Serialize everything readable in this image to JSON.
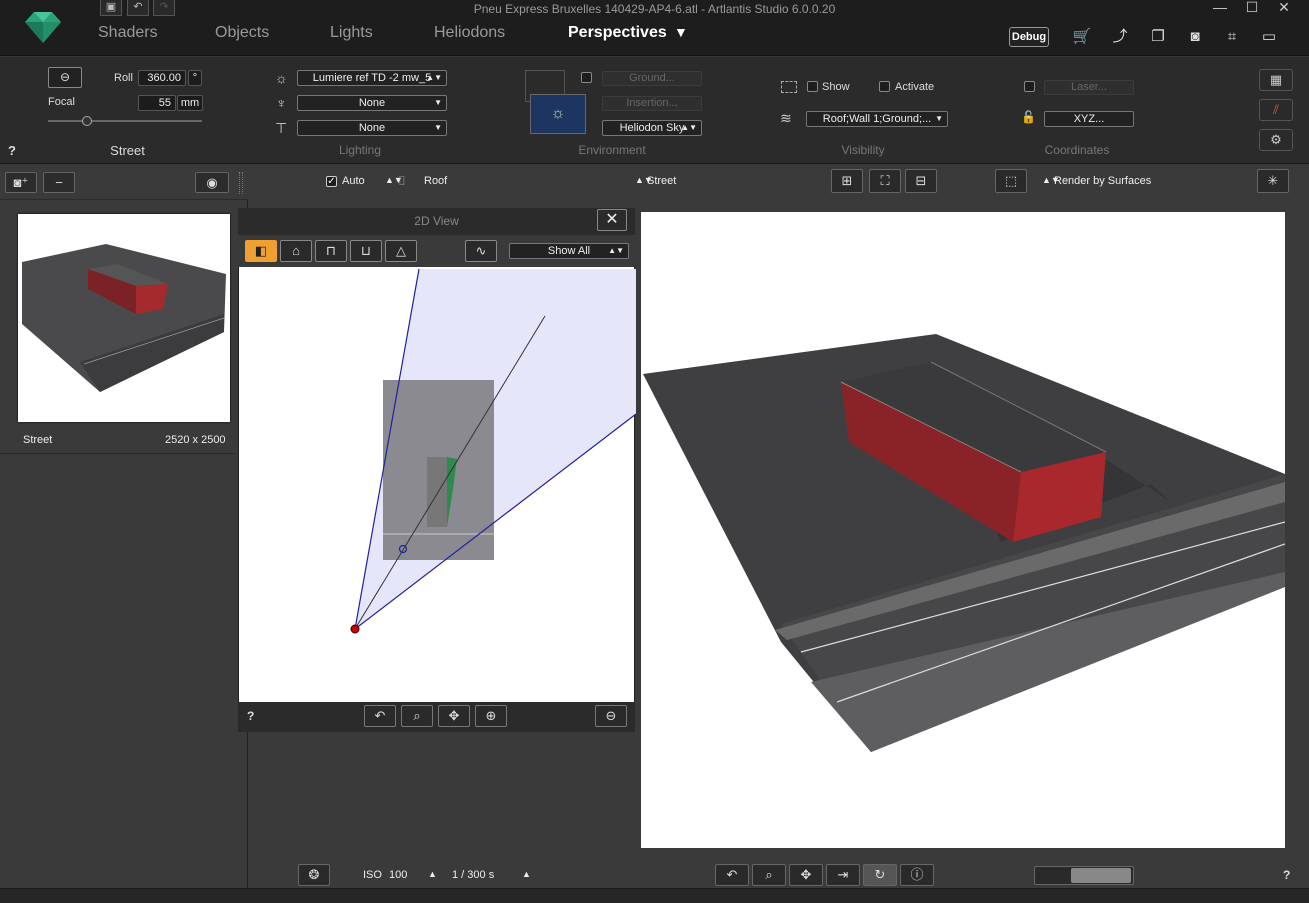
{
  "window": {
    "title": "Pneu Express Bruxelles 140429-AP4-6.atl - Artlantis Studio 6.0.0.20",
    "quick_save_icon": "save-icon",
    "undo_icon": "undo-icon",
    "redo_icon": "redo-icon"
  },
  "menu": {
    "tabs": [
      "Shaders",
      "Objects",
      "Lights",
      "Heliodons",
      "Perspectives"
    ],
    "active": "Perspectives",
    "debug_label": "Debug"
  },
  "props": {
    "roll_label": "Roll",
    "roll_value": "360.00",
    "roll_unit": "°",
    "focal_label": "Focal",
    "focal_value": "55",
    "focal_unit": "mm",
    "focal_slider_fraction": 0.25,
    "view_name": "Street",
    "help": "?",
    "lighting": {
      "sun_value": "Lumiere ref TD -2 mw_5",
      "lamp_value": "None",
      "paint_value": "None",
      "title": "Lighting"
    },
    "environment": {
      "ground": "Ground...",
      "insertion": "Insertion...",
      "sky": "Heliodon Sky",
      "title": "Environment"
    },
    "visibility": {
      "show_label": "Show",
      "activate_label": "Activate",
      "layers_value": "Roof;Wall 1;Ground;...",
      "title": "Visibility"
    },
    "coordinates": {
      "laser": "Laser...",
      "xyz": "XYZ...",
      "title": "Coordinates"
    }
  },
  "viewport_toolbar": {
    "auto_label": "Auto",
    "auto_checked": true,
    "roof_label": "Roof",
    "street_label": "Street",
    "render_mode": "Render by Surfaces"
  },
  "left_panel": {
    "thumb_name": "Street",
    "thumb_size": "2520 x 2500"
  },
  "view2d": {
    "title": "2D View",
    "filter": "Show All",
    "help": "?"
  },
  "bottom": {
    "iso_label": "ISO",
    "iso_value": "100",
    "shutter_value": "1 / 300 s",
    "help": "?"
  },
  "colors": {
    "accent": "#f0a030",
    "frustum": "#e6e6fa",
    "frustum_line": "#2020a0",
    "camera_point": "#cc0000"
  }
}
